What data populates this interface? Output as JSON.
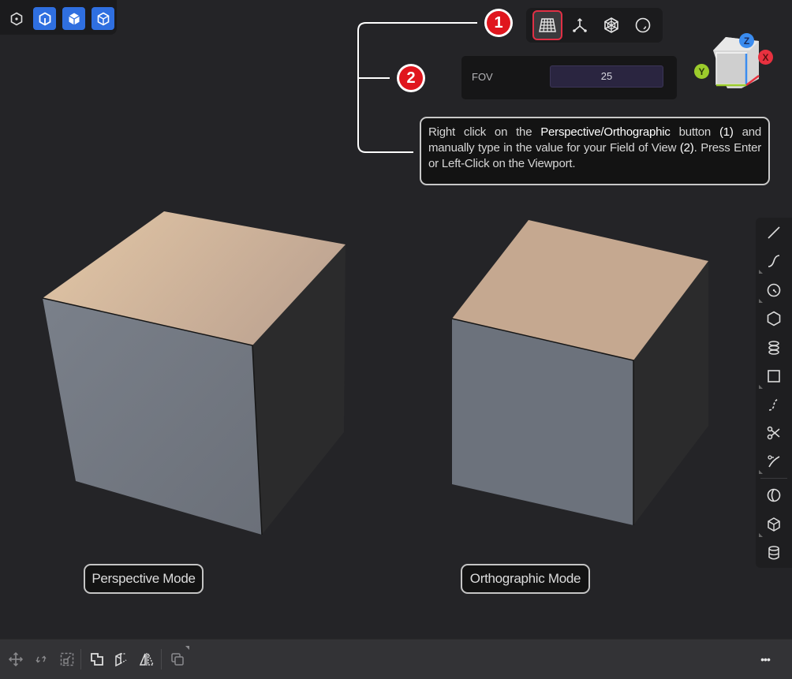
{
  "top_left_toolbar": {
    "buttons": [
      {
        "icon": "hexagon-dot-icon",
        "active": false
      },
      {
        "icon": "cube-cutaway-icon",
        "active": true
      },
      {
        "icon": "cube-solid-icon",
        "active": true
      },
      {
        "icon": "cube-wireframe-icon",
        "active": true
      }
    ],
    "accent_color": "#2f6fe0"
  },
  "view_toolbar": {
    "buttons": [
      {
        "icon": "perspective-grid-icon",
        "label": "Perspective/Orthographic",
        "selected": true
      },
      {
        "icon": "axes-icon"
      },
      {
        "icon": "wireframe-sphere-icon"
      },
      {
        "icon": "circle-dot-icon"
      }
    ],
    "highlight_color": "#e03045"
  },
  "fov_panel": {
    "label": "FOV",
    "value": "25"
  },
  "callouts": {
    "one": "1",
    "two": "2",
    "color": "#e0161e"
  },
  "tip": {
    "text_1": "Right click on the ",
    "bold_1": "Perspective/Orthographic",
    "text_2": " button ",
    "bold_2": "(1)",
    "text_3": " and manually type in the value for your Field of View ",
    "bold_3": "(2)",
    "text_4": ". Press Enter or Left-Click on the Viewport."
  },
  "nav_cube": {
    "x_label": "X",
    "y_label": "Y",
    "z_label": "Z",
    "x_color": "#e8313f",
    "y_color": "#9ccc2c",
    "z_color": "#3a8cf0"
  },
  "viewport": {
    "perspective_label": "Perspective Mode",
    "orthographic_label": "Orthographic Mode",
    "top_face_color": "#d9bc9c",
    "front_face_color": "#6e7480",
    "side_face_color": "#2b2b2c"
  },
  "right_panel": {
    "tools": [
      {
        "icon": "line-icon"
      },
      {
        "icon": "curve-icon"
      },
      {
        "icon": "circle-icon"
      },
      {
        "icon": "hexagon-icon"
      },
      {
        "icon": "spiral-stack-icon"
      },
      {
        "icon": "rectangle-icon"
      },
      {
        "icon": "dashed-curve-icon"
      },
      {
        "icon": "scissors-icon"
      },
      {
        "icon": "trim-curve-icon"
      },
      {
        "icon": "crescent-icon"
      },
      {
        "icon": "cube-icon"
      },
      {
        "icon": "cylinder-icon"
      }
    ]
  },
  "bottom_bar": {
    "tools": [
      {
        "icon": "move-icon"
      },
      {
        "icon": "rotate-icon"
      },
      {
        "icon": "scale-icon"
      },
      {
        "icon": "boolean-union-icon"
      },
      {
        "icon": "extrude-icon"
      },
      {
        "icon": "mirror-icon"
      },
      {
        "icon": "duplicate-icon"
      }
    ],
    "more_label": "•••"
  }
}
